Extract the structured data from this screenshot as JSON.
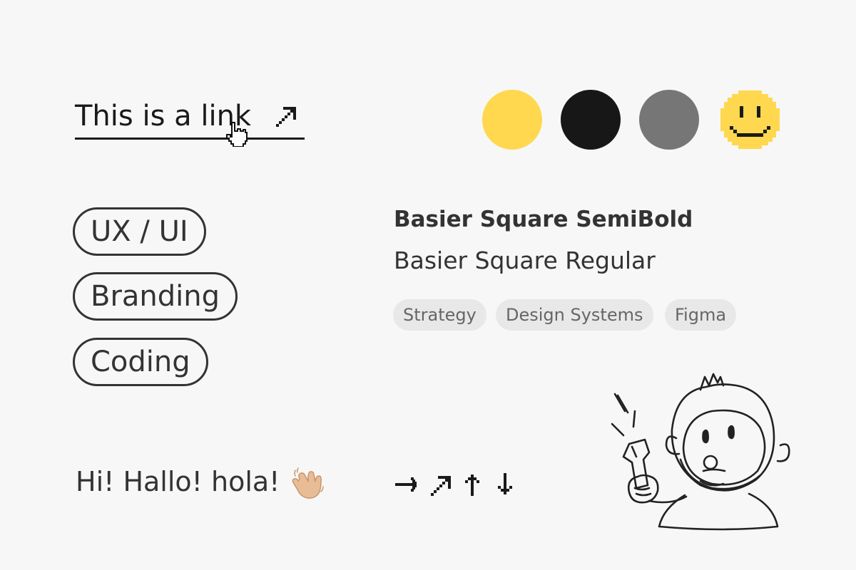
{
  "link": {
    "label": "This is a link"
  },
  "tags_primary": [
    "UX / UI",
    "Branding",
    "Coding"
  ],
  "typography": {
    "semibold_sample": "Basier Square SemiBold",
    "regular_sample": "Basier Square Regular"
  },
  "tags_secondary": [
    "Strategy",
    "Design Systems",
    "Figma"
  ],
  "greeting": "Hi! Hallo! hola!",
  "colors": {
    "yellow": "#ffd84f",
    "black": "#171717",
    "gray": "#767676",
    "background": "#f7f7f7"
  },
  "icons": [
    "arrow-up-right-icon",
    "hand-pointer-icon",
    "smiley-icon",
    "waving-hand-icon",
    "arrow-right-icon",
    "arrow-up-right-icon",
    "arrow-up-icon",
    "arrow-down-icon",
    "mascot-illustration"
  ]
}
